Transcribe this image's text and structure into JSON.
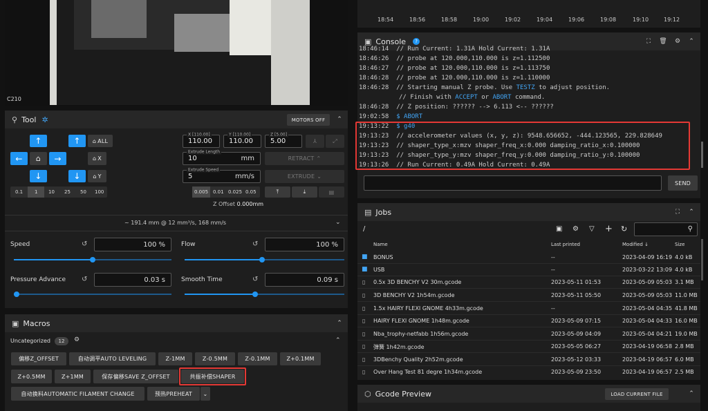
{
  "camera": {
    "label": "C210"
  },
  "tool": {
    "title": "Tool",
    "motors_off": "MOTORS OFF",
    "home_all": "ALL",
    "home_x": "X",
    "home_y": "Y",
    "steps": [
      "0.1",
      "1",
      "10",
      "25",
      "50",
      "100"
    ],
    "x_label": "X [110.00]",
    "x_value": "110.00",
    "y_label": "Y [110.00]",
    "y_value": "110.00",
    "z_label": "Z [5.00]",
    "z_value": "5.00",
    "extrude_length_label": "Extrude Length",
    "extrude_length_value": "10",
    "extrude_length_unit": "mm",
    "extrude_speed_label": "Extrude Speed",
    "extrude_speed_value": "5",
    "extrude_speed_unit": "mm/s",
    "retract": "RETRACT",
    "extrude": "EXTRUDE",
    "z_steps": [
      "0.005",
      "0.01",
      "0.025",
      "0.05"
    ],
    "z_offset_label": "Z Offset",
    "z_offset_value": "0.000mm",
    "flow_info": "~ 191.4 mm @ 12 mm³/s, 168 mm/s",
    "speed_label": "Speed",
    "speed_value": "100 %",
    "speed_pct": 0.5,
    "flow_label": "Flow",
    "flow_value": "100 %",
    "flow_pct": 0.5,
    "pa_label": "Pressure Advance",
    "pa_value": "0.03 s",
    "pa_pct": 0.03,
    "st_label": "Smooth Time",
    "st_value": "0.09 s",
    "st_pct": 0.45
  },
  "macros": {
    "title": "Macros",
    "group": "Uncategorized",
    "count": "12",
    "row1": [
      "偏移Z_OFFSET",
      "自动调平AUTO LEVELING",
      "Z-1MM",
      "Z-0.5MM",
      "Z-0.1MM",
      "Z+0.1MM"
    ],
    "row2": [
      "Z+0.5MM",
      "Z+1MM",
      "保存偏移SAVE Z_OFFSET",
      "共振补偿SHAPER"
    ],
    "row3": [
      "自动换料AUTOMATIC FILAMENT CHANGE",
      "预热PREHEAT"
    ]
  },
  "chart_axis": [
    "18:54",
    "18:56",
    "18:58",
    "19:00",
    "19:02",
    "19:04",
    "19:06",
    "19:08",
    "19:10",
    "19:12"
  ],
  "console": {
    "title": "Console",
    "send": "SEND",
    "input_value": "",
    "lines": [
      {
        "ts": "18:46:14",
        "t": "// Run Current: 1.31A Hold Current: 1.31A"
      },
      {
        "ts": "18:46:26",
        "t": "// probe at 120.000,110.000 is z=1.112500"
      },
      {
        "ts": "18:46:27",
        "t": "// probe at 120.000,110.000 is z=1.113750"
      },
      {
        "ts": "18:46:28",
        "t": "// probe at 120.000,110.000 is z=1.110000"
      },
      {
        "ts": "18:46:28",
        "t": "// Starting manual Z probe. Use ",
        "l": "TESTZ",
        "r": " to adjust position."
      },
      {
        "ts": "",
        "t": "// Finish with ",
        "l": "ACCEPT",
        "r": " or ",
        "l2": "ABORT",
        "r2": " command."
      },
      {
        "ts": "18:46:28",
        "t": "// Z position: ?????? --> 6.113 <-- ??????"
      },
      {
        "ts": "19:02:58",
        "t": "",
        "l": "$ ABORT"
      },
      {
        "ts": "19:13:22",
        "t": "",
        "l": "$ g40"
      },
      {
        "ts": "19:13:23",
        "t": "// accelerometer values (x, y, z): 9548.656652, -444.123565, 229.828649"
      },
      {
        "ts": "19:13:23",
        "t": "// shaper_type_x:mzv shaper_freq_x:0.000 damping_ratio_x:0.100000"
      },
      {
        "ts": "19:13:23",
        "t": "// shaper_type_y:mzv shaper_freq_y:0.000 damping_ratio_y:0.100000"
      },
      {
        "ts": "19:13:26",
        "t": "// Run Current: 0.49A Hold Current: 0.49A"
      }
    ]
  },
  "jobs": {
    "title": "Jobs",
    "path": "/",
    "cols": {
      "name": "Name",
      "last": "Last printed",
      "modified": "Modified",
      "size": "Size"
    },
    "rows": [
      {
        "name": "BONUS",
        "last": "--",
        "mod": "2023-04-09 16:19",
        "size": "4.0 kB",
        "folder": true
      },
      {
        "name": "USB",
        "last": "--",
        "mod": "2023-03-22 13:09",
        "size": "4.0 kB",
        "folder": true
      },
      {
        "name": "0.5x 3D BENCHY V2 30m.gcode",
        "last": "2023-05-11 01:53",
        "mod": "2023-05-09 05:03",
        "size": "3.1 MB"
      },
      {
        "name": "3D BENCHY V2 1h54m.gcode",
        "last": "2023-05-11 05:50",
        "mod": "2023-05-09 05:03",
        "size": "11.0 MB"
      },
      {
        "name": "1.5x HAIRY FLEXI GNOME 4h33m.gcode",
        "last": "--",
        "mod": "2023-05-04 04:35",
        "size": "41.8 MB"
      },
      {
        "name": "HAIRY FLEXI GNOME 1h48m.gcode",
        "last": "2023-05-09 07:15",
        "mod": "2023-05-04 04:33",
        "size": "16.0 MB"
      },
      {
        "name": "Nba_trophy-netfabb 1h56m.gcode",
        "last": "2023-05-09 04:09",
        "mod": "2023-05-04 04:21",
        "size": "19.0 MB"
      },
      {
        "name": "弹簧 1h42m.gcode",
        "last": "2023-05-05 06:27",
        "mod": "2023-04-19 06:58",
        "size": "2.8 MB"
      },
      {
        "name": "3DBenchy Quality 2h52m.gcode",
        "last": "2023-05-12 03:33",
        "mod": "2023-04-19 06:57",
        "size": "6.0 MB"
      },
      {
        "name": "Over Hang Test 81 degre 1h34m.gcode",
        "last": "2023-05-09 23:50",
        "mod": "2023-04-19 06:57",
        "size": "2.5 MB"
      }
    ]
  },
  "gcode": {
    "title": "Gcode Preview",
    "load": "LOAD CURRENT FILE"
  }
}
